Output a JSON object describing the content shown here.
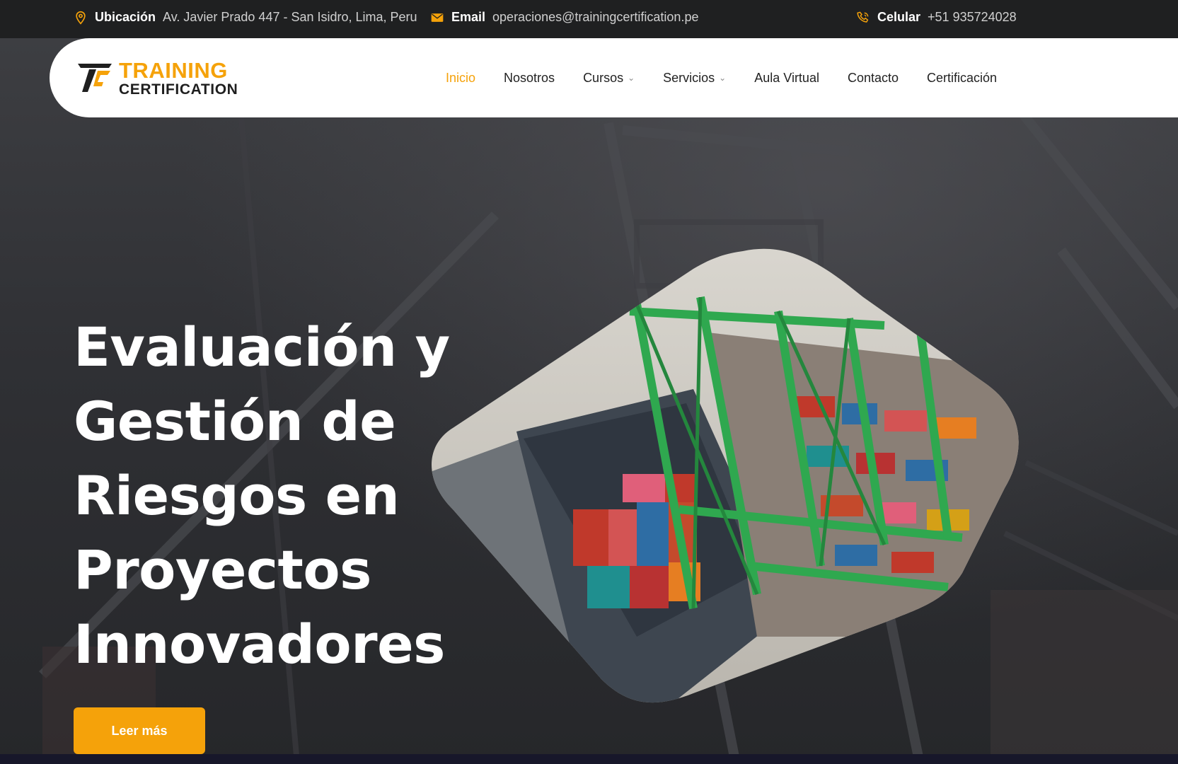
{
  "topbar": {
    "location_label": "Ubicación",
    "location_value": "Av. Javier Prado 447 - San Isidro, Lima, Peru",
    "email_label": "Email",
    "email_value": "operaciones@trainingcertification.pe",
    "phone_label": "Celular",
    "phone_value": "+51 935724028"
  },
  "logo": {
    "line1": "TRAINING",
    "line2": "CERTIFICATION"
  },
  "nav": {
    "items": [
      {
        "label": "Inicio",
        "active": true
      },
      {
        "label": "Nosotros"
      },
      {
        "label": "Cursos",
        "dropdown": true
      },
      {
        "label": "Servicios",
        "dropdown": true
      },
      {
        "label": "Aula Virtual"
      },
      {
        "label": "Contacto"
      },
      {
        "label": "Certificación"
      }
    ]
  },
  "hero": {
    "title_lines": [
      "Evaluación y",
      "Gestión de",
      "Riesgos en",
      "Proyectos",
      "Innovadores"
    ],
    "cta_label": "Leer más"
  },
  "colors": {
    "accent": "#f5a20a",
    "topbar_bg": "#1f2021",
    "nav_bg": "#ffffff"
  },
  "icons": {
    "location": "map-pin-icon",
    "email": "envelope-icon",
    "phone": "phone-icon"
  }
}
